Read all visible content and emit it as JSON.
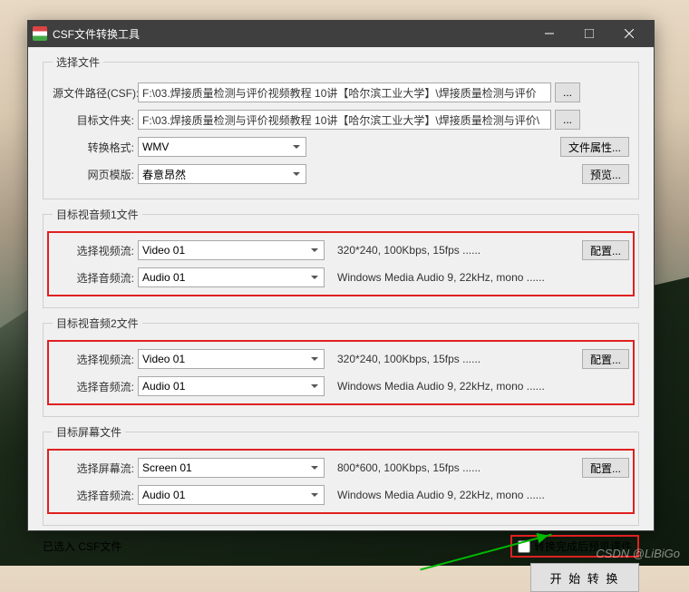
{
  "window": {
    "title": "CSF文件转换工具"
  },
  "g1": {
    "legend": "选择文件",
    "src_lbl": "源文件路径(CSF):",
    "src_val": "F:\\03.焊接质量检测与评价视频教程 10讲【哈尔滨工业大学】\\焊接质量检测与评价",
    "dst_lbl": "目标文件夹:",
    "dst_val": "F:\\03.焊接质量检测与评价视频教程 10讲【哈尔滨工业大学】\\焊接质量检测与评价\\",
    "fmt_lbl": "转换格式:",
    "fmt_val": "WMV",
    "tpl_lbl": "网页模版:",
    "tpl_val": "春意昂然",
    "browse": "...",
    "prop": "文件属性...",
    "preview": "预览..."
  },
  "g2": {
    "legend": "目标视音频1文件",
    "v_lbl": "选择视频流:",
    "v_val": "Video 01",
    "v_info": "320*240, 100Kbps, 15fps ......",
    "a_lbl": "选择音频流:",
    "a_val": "Audio 01",
    "a_info": "Windows Media Audio 9, 22kHz, mono ......",
    "cfg": "配置..."
  },
  "g3": {
    "legend": "目标视音频2文件",
    "v_lbl": "选择视频流:",
    "v_val": "Video 01",
    "v_info": "320*240, 100Kbps, 15fps ......",
    "a_lbl": "选择音频流:",
    "a_val": "Audio 01",
    "a_info": "Windows Media Audio 9, 22kHz, mono ......",
    "cfg": "配置..."
  },
  "g4": {
    "legend": "目标屏幕文件",
    "s_lbl": "选择屏幕流:",
    "s_val": "Screen 01",
    "s_info": "800*600, 100Kbps, 15fps ......",
    "a_lbl": "选择音频流:",
    "a_val": "Audio 01",
    "a_info": "Windows Media Audio 9, 22kHz, mono ......",
    "cfg": "配置..."
  },
  "bottom": {
    "loaded": "已选入 CSF文件",
    "chk": "转换完成后预览课件",
    "start": "开 始 转 换"
  },
  "watermark": "CSDN @LiBiGo"
}
